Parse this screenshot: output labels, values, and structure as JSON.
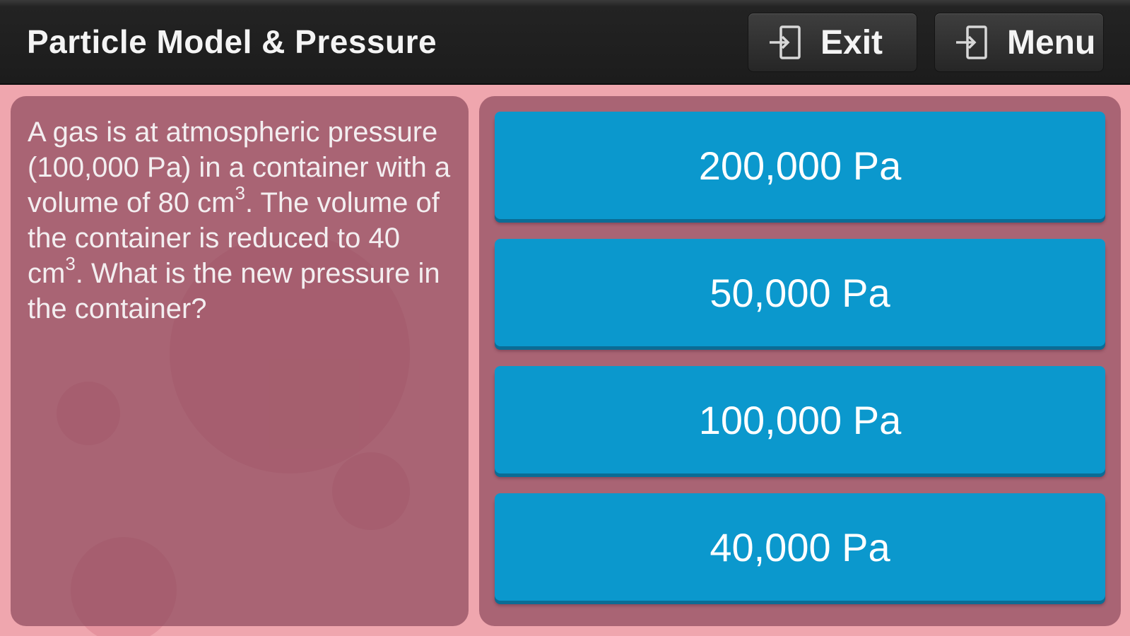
{
  "header": {
    "title": "Particle Model & Pressure",
    "exit_label": "Exit",
    "menu_label": "Menu",
    "exit_icon": "exit-icon",
    "menu_icon": "menu-exit-icon"
  },
  "question": {
    "part1": "A gas is at atmospheric pressure (100,000 Pa) in a container with a volume of 80 cm",
    "sup1": "3",
    "part2": ". The volume of the container is reduced to 40 cm",
    "sup2": "3",
    "part3": ". What is the new pressure in the container?"
  },
  "answers": [
    {
      "label": "200,000 Pa"
    },
    {
      "label": "50,000 Pa"
    },
    {
      "label": "100,000 Pa"
    },
    {
      "label": "40,000 Pa"
    }
  ],
  "colors": {
    "background": "#efa6ae",
    "panel": "#87465880",
    "answer_button": "#0b98cd",
    "topbar": "#1c1c1c"
  }
}
